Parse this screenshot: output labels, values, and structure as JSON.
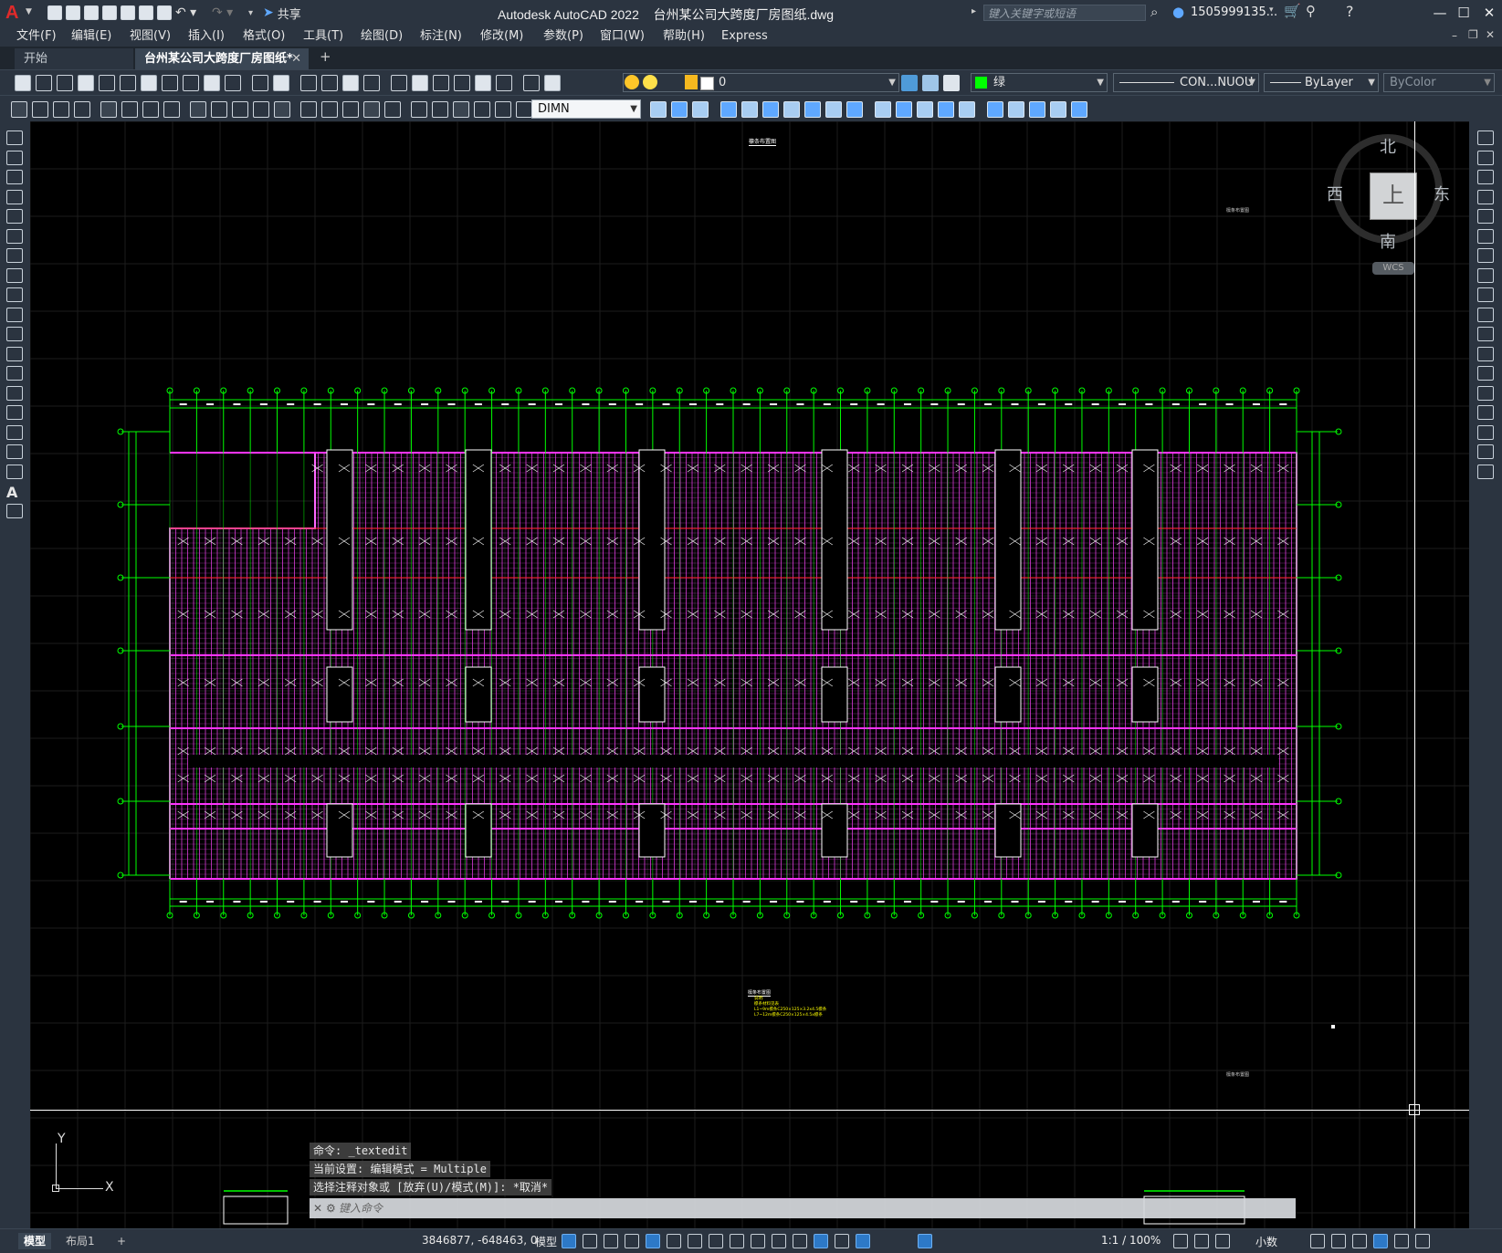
{
  "app": {
    "title": "Autodesk AutoCAD 2022    台州某公司大跨度厂房图纸.dwg",
    "logo": "A",
    "share_label": "共享",
    "search_placeholder": "键入关键字或短语",
    "user": "1505999135...",
    "accent": "#2d79c7"
  },
  "menu": [
    "文件(F)",
    "编辑(E)",
    "视图(V)",
    "插入(I)",
    "格式(O)",
    "工具(T)",
    "绘图(D)",
    "标注(N)",
    "修改(M)",
    "参数(P)",
    "窗口(W)",
    "帮助(H)",
    "Express"
  ],
  "tabs": {
    "start": "开始",
    "drawing": "台州某公司大跨度厂房图纸*",
    "close": "✕",
    "add": "+"
  },
  "toolbar": {
    "layer_value": "0",
    "color_value": "绿",
    "linetype_value": "CON...NUOU",
    "lineweight_value": "ByLayer",
    "plotstyle_value": "ByColor",
    "dimstyle_value": "DIMN"
  },
  "viewcube": {
    "north": "北",
    "south": "南",
    "east": "东",
    "west": "西",
    "top": "上",
    "wcs": "WCS"
  },
  "ucs": {
    "x": "X",
    "y": "Y"
  },
  "drawing": {
    "title_top": "檩条布置图",
    "title_bottom": "檩条布置图",
    "small_label_right": "檩条布置图",
    "small_label_right2": "檩条布置图",
    "note_lines": [
      "说明:",
      "檩条材料见表",
      "L1~9m檩条C250×125×3.2x4.5檩条",
      "L7~12m檩条C250×125×4.5x檩条"
    ],
    "grid_color": "#00ff00",
    "purlin_color": "#e040e0",
    "axis_red": "#ff2020"
  },
  "command": {
    "lines": [
      "命令: _textedit",
      "当前设置: 编辑模式 = Multiple",
      "选择注释对象或 [放弃(U)/模式(M)]: *取消*"
    ],
    "input_placeholder": "键入命令"
  },
  "status": {
    "model_tab": "模型",
    "layout_tab": "布局1",
    "add": "+",
    "coords": "3846877, -648463, 0",
    "model_label": "模型",
    "scale": "1:1 / 100%",
    "units": "小数"
  }
}
